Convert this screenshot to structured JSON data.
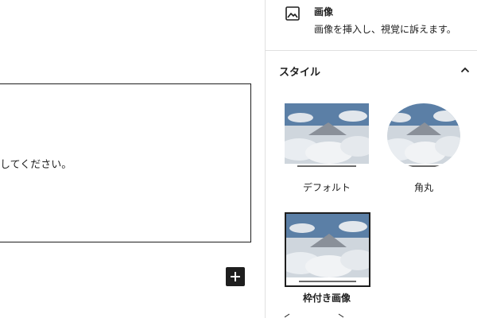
{
  "editor": {
    "placeholder_text": "してください。",
    "add_block_icon": "plus-icon"
  },
  "sidebar": {
    "block": {
      "icon": "image-icon",
      "title": "画像",
      "description": "画像を挿入し、視覚に訴えます。"
    },
    "styles": {
      "title": "スタイル",
      "chevron_icon": "chevron-up-icon",
      "options": [
        {
          "label": "デフォルト",
          "selected": false
        },
        {
          "label": "角丸",
          "selected": false
        },
        {
          "label": "枠付き画像",
          "selected": true
        }
      ]
    }
  },
  "colors": {
    "text": "#1e1e1e",
    "border": "#e0e0e0",
    "sky": "#5b7fa6",
    "cloud": "#e7ebef"
  }
}
